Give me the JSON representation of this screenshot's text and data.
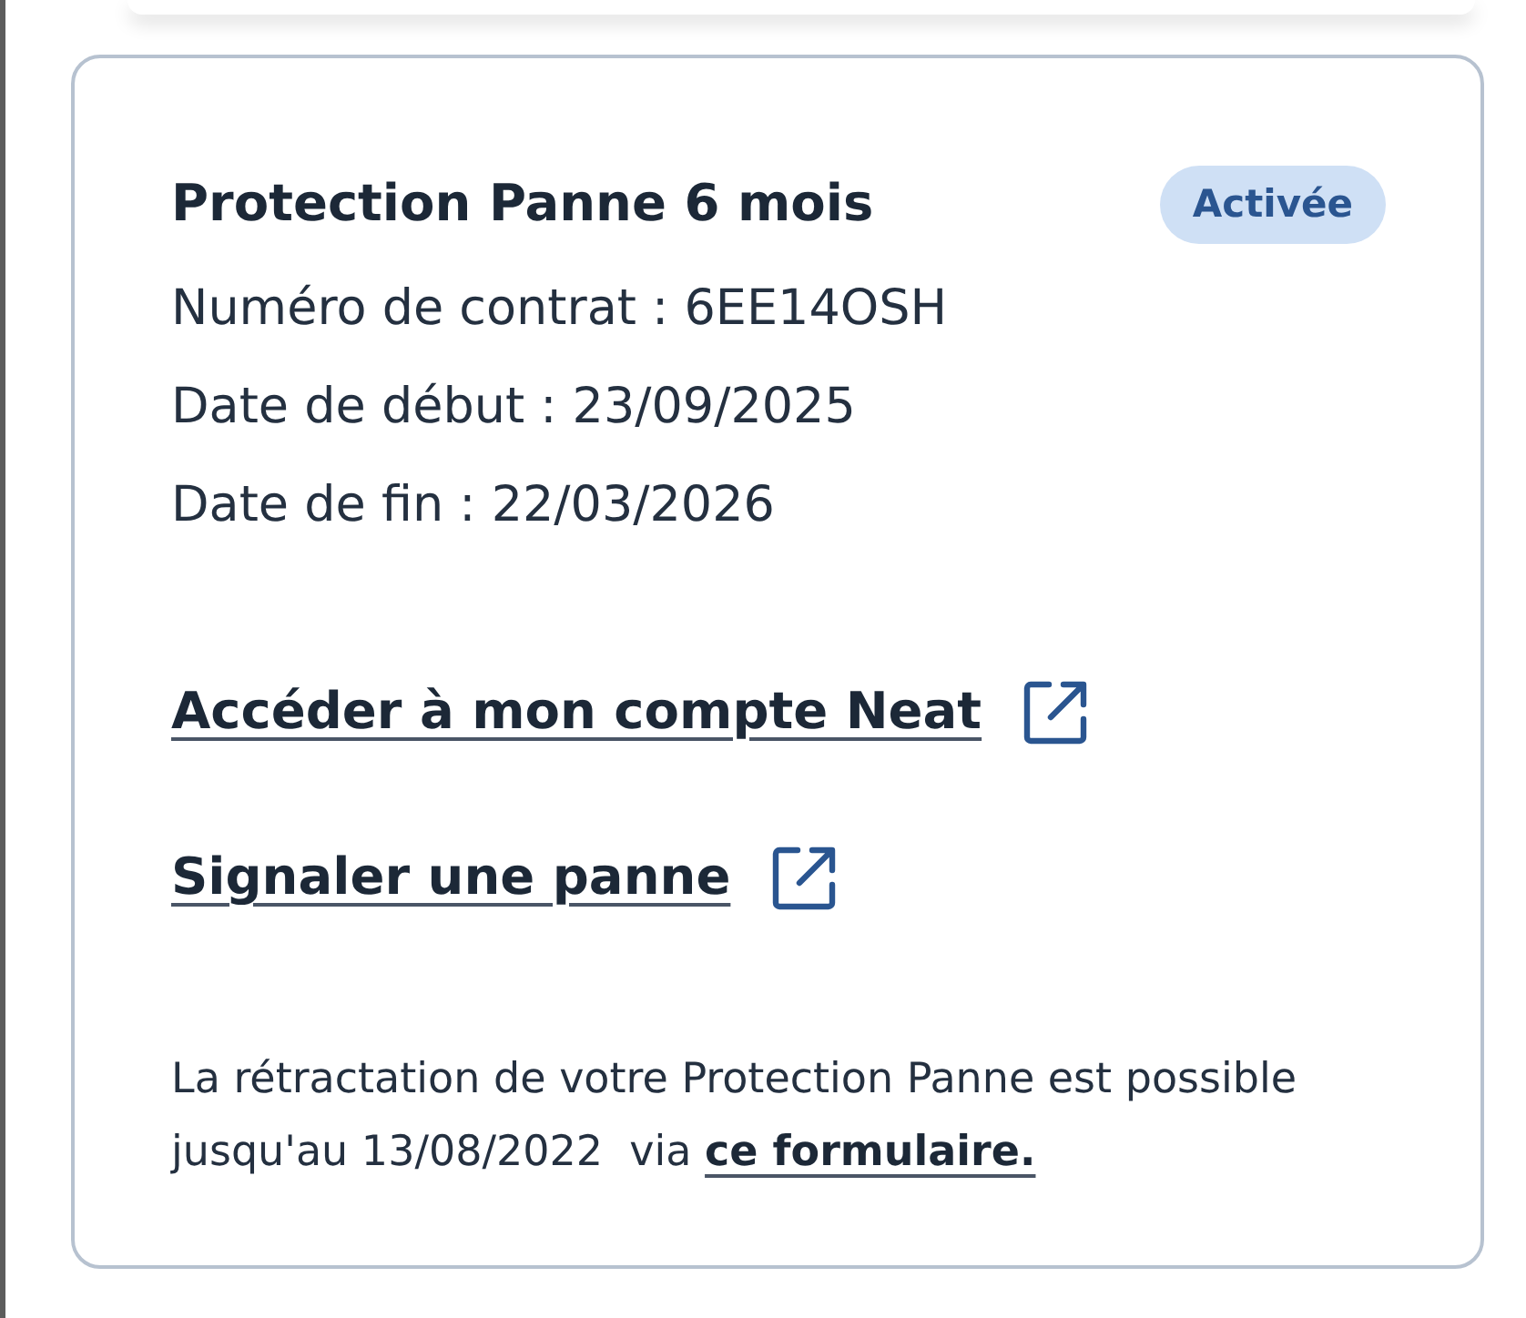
{
  "contract": {
    "title": "Protection Panne 6 mois",
    "status": {
      "label": "Activée",
      "kind": "active"
    },
    "details": [
      "Numéro de contrat : 6EE14OSH",
      "Date de début : 23/09/2025",
      "Date de fin : 22/03/2026"
    ]
  },
  "links": [
    {
      "label": "Accéder à mon compte Neat",
      "external": true
    },
    {
      "label": "Signaler une panne",
      "external": true
    }
  ],
  "notice": {
    "text": "La rétractation de votre Protection Panne est possible jusqu'au 13/08/2022  via",
    "link": "ce formulaire."
  }
}
